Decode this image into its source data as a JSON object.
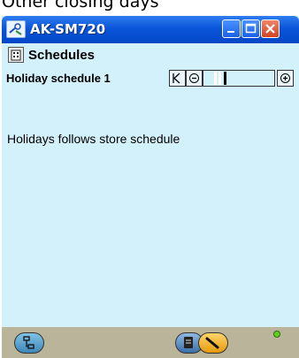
{
  "heading": "Other closing days",
  "window": {
    "title": "AK-SM720",
    "icon": "wrench-icon",
    "controls": [
      "minimize-icon",
      "maximize-icon",
      "close-icon"
    ],
    "colors": {
      "titlebar": "#0a55d9",
      "content": "#d3f1fb",
      "bottombar": "#b9b49a",
      "close": "#d3421f"
    }
  },
  "section": {
    "title": "Schedules",
    "icon": "building-icon"
  },
  "schedule": {
    "title": "Holiday schedule 1",
    "pager_buttons": [
      "first-page-icon",
      "previous-icon",
      "next-icon"
    ]
  },
  "main": {
    "message": "Holidays follows store schedule"
  },
  "bottom": {
    "buttons": [
      "network-icon",
      "notes-icon",
      "service-icon"
    ],
    "status_color": "#5fd11c"
  }
}
